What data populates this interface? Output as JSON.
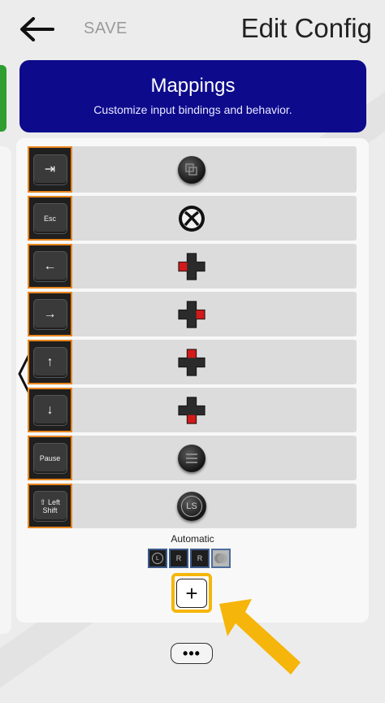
{
  "topbar": {
    "back_icon": "arrow-left-icon",
    "save_label": "SAVE",
    "title": "Edit Config"
  },
  "header": {
    "title": "Mappings",
    "subtitle": "Customize input bindings and behavior."
  },
  "mappings": [
    {
      "key": "⇥",
      "button": "view-button-icon",
      "kind": "arrow"
    },
    {
      "key": "Esc",
      "button": "xbox-guide-icon",
      "kind": "text"
    },
    {
      "key": "←",
      "button": "dpad-left-icon",
      "kind": "arrow"
    },
    {
      "key": "→",
      "button": "dpad-right-icon",
      "kind": "arrow"
    },
    {
      "key": "↑",
      "button": "dpad-up-icon",
      "kind": "arrow"
    },
    {
      "key": "↓",
      "button": "dpad-down-icon",
      "kind": "arrow"
    },
    {
      "key": "Pause",
      "button": "menu-button-icon",
      "kind": "text"
    },
    {
      "key": "⇧ Left Shift",
      "button": "left-stick-button-icon",
      "kind": "text",
      "stick_label": "LS"
    }
  ],
  "automatic": {
    "label": "Automatic",
    "icons": [
      "L",
      "R",
      "R",
      ""
    ]
  },
  "add_button": {
    "label": "+"
  },
  "more_button": {
    "label": "•••"
  },
  "colors": {
    "header_bg": "#0d0a8c",
    "key_border": "#e8851e",
    "highlight": "#f5b50a",
    "dpad_active": "#d11a1a"
  }
}
